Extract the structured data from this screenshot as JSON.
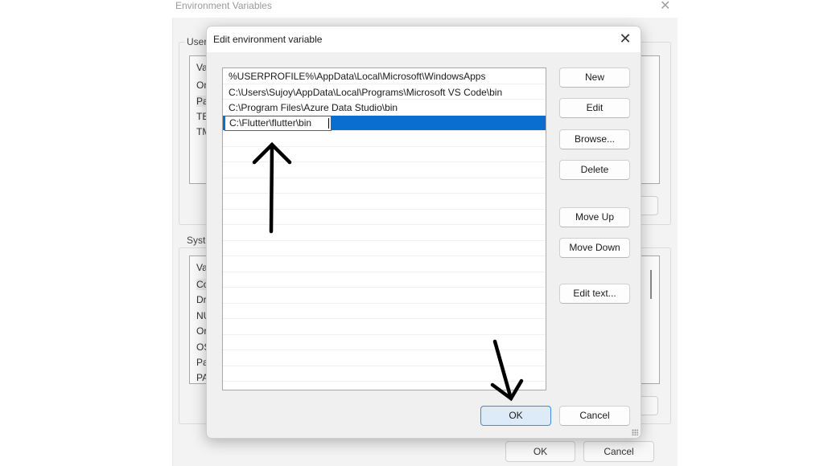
{
  "outer_window": {
    "title": "Environment Variables",
    "user_group_label": "User",
    "user_list": {
      "header": "Va",
      "rows": [
        "On",
        "Pa",
        "TE",
        "TM"
      ]
    },
    "system_group_label": "Syste",
    "system_list": {
      "header": "Va",
      "rows": [
        "Co",
        "Dr",
        "NU",
        "Or",
        "OS",
        "Pa",
        "PA"
      ]
    },
    "ok_label": "OK",
    "cancel_label": "Cancel"
  },
  "dialog": {
    "title": "Edit environment variable",
    "entries": [
      "%USERPROFILE%\\AppData\\Local\\Microsoft\\WindowsApps",
      "C:\\Users\\Sujoy\\AppData\\Local\\Programs\\Microsoft VS Code\\bin",
      "C:\\Program Files\\Azure Data Studio\\bin"
    ],
    "editing_value": "C:\\Flutter\\flutter\\bin",
    "buttons": {
      "new": "New",
      "edit": "Edit",
      "browse": "Browse...",
      "delete": "Delete",
      "move_up": "Move Up",
      "move_down": "Move Down",
      "edit_text": "Edit text...",
      "ok": "OK",
      "cancel": "Cancel"
    },
    "selection_color": "#0a6ed1"
  },
  "annotations": {
    "arrow_color": "#000000",
    "arrows": [
      "up-arrow-to-new-entry",
      "down-arrow-to-ok"
    ]
  }
}
